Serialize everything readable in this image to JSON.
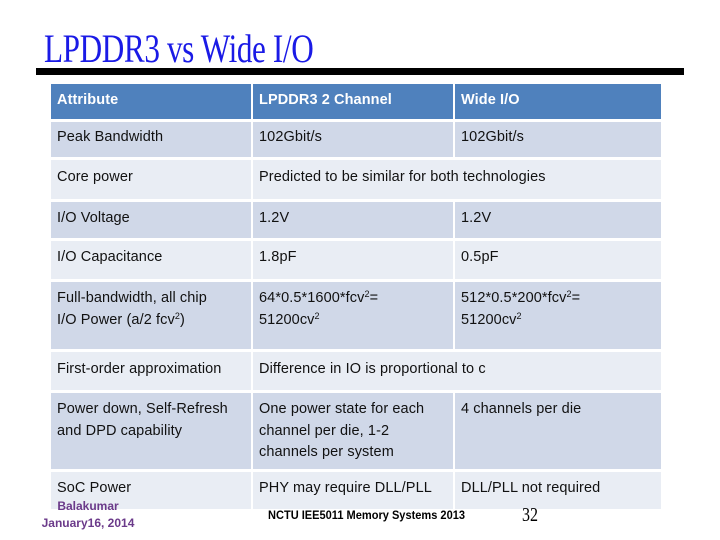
{
  "slide": {
    "title": "LPDDR3 vs Wide I/O"
  },
  "table": {
    "header": [
      "Attribute",
      "LPDDR3 2 Channel",
      "Wide I/O"
    ],
    "rows": [
      {
        "attribute": "Peak Bandwidth",
        "lpddr3": "102Gbit/s",
        "wide_io": "102Gbit/s"
      },
      {
        "attribute": "Core power",
        "merged": "Predicted to be similar for both technologies"
      },
      {
        "attribute": "I/O Voltage",
        "lpddr3": "1.2V",
        "wide_io": "1.2V"
      },
      {
        "attribute": "I/O Capacitance",
        "lpddr3": "1.8pF",
        "wide_io": "0.5pF"
      },
      {
        "attribute_line1": "Full-bandwidth, all chip",
        "attribute_line2_prefix": "I/O Power (a/2 fcv",
        "attribute_line2_sup": "2",
        "attribute_line2_suffix": ")",
        "lpddr3_line1_prefix": "64*0.5*1600*fcv",
        "lpddr3_line1_sup": "2",
        "lpddr3_line1_suffix": "=",
        "lpddr3_line2_prefix": "51200cv",
        "lpddr3_line2_sup": "2",
        "wide_io_line1_prefix": "512*0.5*200*fcv",
        "wide_io_line1_sup": "2",
        "wide_io_line1_suffix": "=",
        "wide_io_line2_prefix": "51200cv",
        "wide_io_line2_sup": "2"
      },
      {
        "attribute": "First-order approximation",
        "merged": "Difference in IO is proportional to c"
      },
      {
        "attribute": "Power down, Self-Refresh and DPD capability",
        "lpddr3": "One power state for each channel per die, 1-2 channels per system",
        "wide_io": "4 channels per die"
      },
      {
        "attribute": "SoC Power",
        "lpddr3": "PHY may require DLL/PLL",
        "wide_io": "DLL/PLL not required"
      }
    ]
  },
  "footer": {
    "author": "Balakumar",
    "date": "January16, 2014",
    "course": "NCTU IEE5011 Memory Systems 2013",
    "page_number": "32"
  },
  "colors": {
    "title": "#1a1ae6",
    "header_bg": "#4f81bd",
    "row_odd_bg": "#d0d8e8",
    "row_even_bg": "#e9edf4",
    "footer_author": "#6b3a8a"
  }
}
